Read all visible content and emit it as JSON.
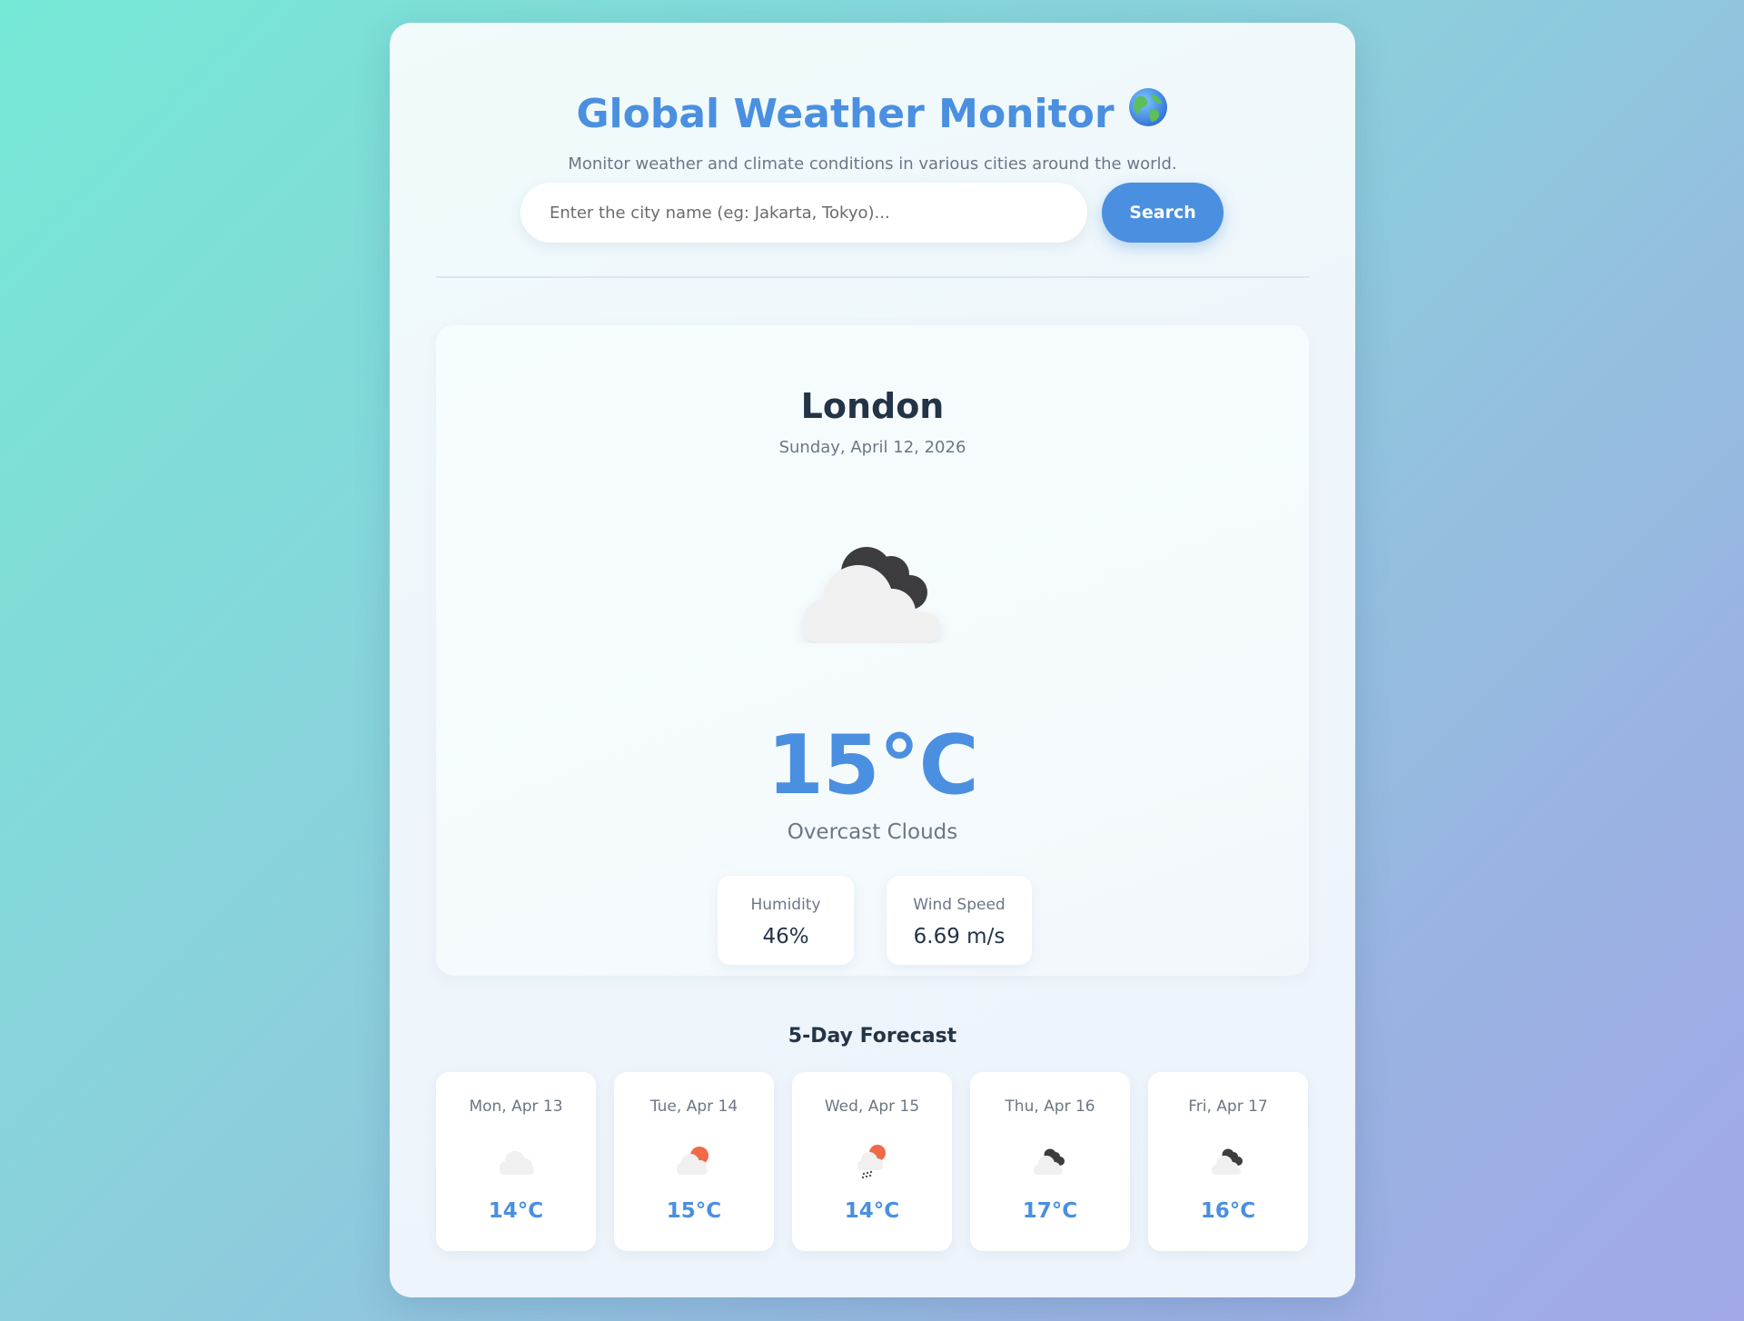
{
  "header": {
    "title": "Global Weather Monitor",
    "title_icon": "globe-icon",
    "subtitle": "Monitor weather and climate conditions in various cities around the world."
  },
  "search": {
    "value": "",
    "placeholder": "Enter the city name (eg: Jakarta, Tokyo)...",
    "button_label": "Search"
  },
  "current": {
    "city": "London",
    "date": "Sunday, April 12, 2026",
    "icon": "overcast-clouds-icon",
    "temperature": "15°C",
    "description": "Overcast Clouds",
    "humidity_label": "Humidity",
    "humidity_value": "46%",
    "wind_label": "Wind Speed",
    "wind_value": "6.69 m/s"
  },
  "forecast": {
    "title": "5-Day Forecast",
    "days": [
      {
        "day": "Mon, Apr 13",
        "icon": "light-cloud-icon",
        "temp": "14°C"
      },
      {
        "day": "Tue, Apr 14",
        "icon": "sun-cloud-icon",
        "temp": "15°C"
      },
      {
        "day": "Wed, Apr 15",
        "icon": "sun-rain-cloud-icon",
        "temp": "14°C"
      },
      {
        "day": "Thu, Apr 16",
        "icon": "overcast-clouds-icon",
        "temp": "17°C"
      },
      {
        "day": "Fri, Apr 17",
        "icon": "overcast-clouds-icon",
        "temp": "16°C"
      }
    ]
  },
  "colors": {
    "accent": "#4a8fe0",
    "text_dark": "#243447",
    "text_muted": "#6b7785",
    "sun": "#ee6a48",
    "dark_cloud": "#3d3d3f",
    "light_cloud": "#f0f0f0"
  }
}
